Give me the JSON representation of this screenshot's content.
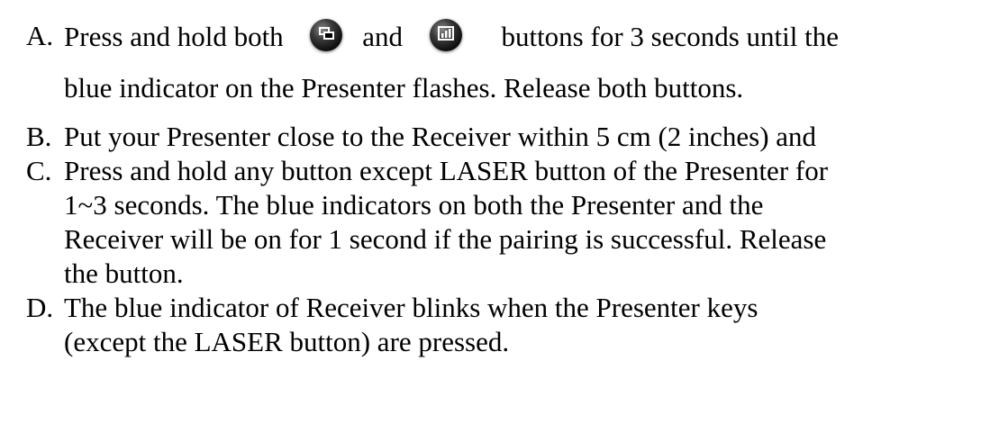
{
  "items": [
    {
      "marker": "A.",
      "segments": [
        "Press and hold both",
        "and",
        "buttons for 3 seconds until the"
      ],
      "icons": [
        "window-switch-icon",
        "presentation-icon"
      ],
      "continuation": [
        "blue indicator on the Presenter flashes. Release both buttons."
      ]
    },
    {
      "marker": "B.",
      "lines": [
        "Put your Presenter close to the Receiver within 5 cm (2 inches) and"
      ]
    },
    {
      "marker": "C.",
      "lines": [
        "Press and hold any button except LASER button of the Presenter for",
        "1~3 seconds. The blue indicators on both the Presenter and the",
        "Receiver will be on for 1 second if the pairing is successful. Release",
        "the button."
      ]
    },
    {
      "marker": "D.",
      "lines": [
        "The blue indicator of Receiver blinks when the Presenter keys",
        "(except the LASER button) are pressed."
      ]
    }
  ]
}
